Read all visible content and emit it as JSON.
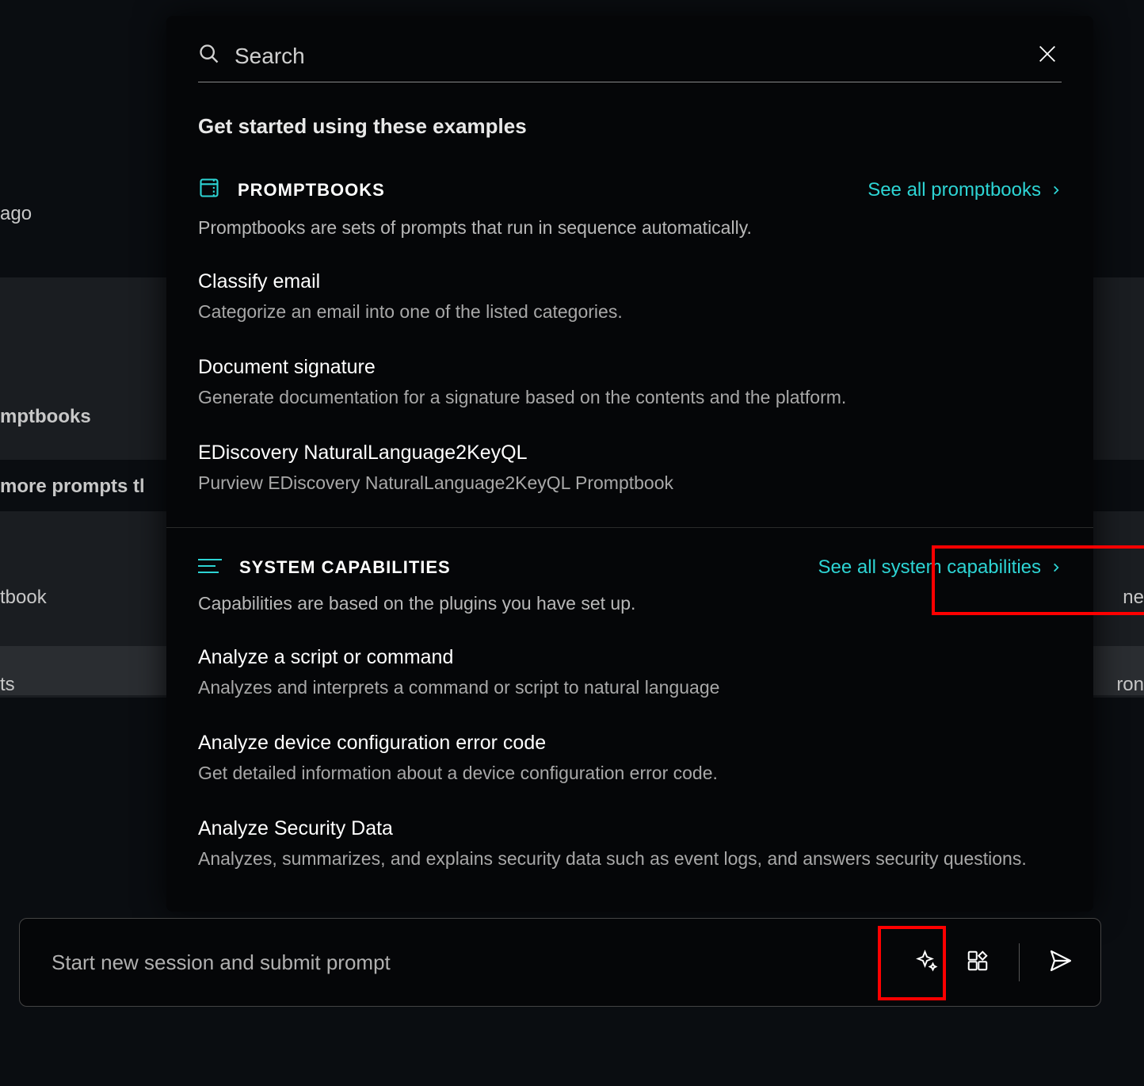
{
  "background": {
    "ago": "ago",
    "mptbooks": "mptbooks",
    "more_prompts": "more prompts tl",
    "tbook": "tbook",
    "ts": "ts",
    "ne": "ne",
    "ron": "ron"
  },
  "search": {
    "placeholder": "Search"
  },
  "intro_heading": "Get started using these examples",
  "promptbooks": {
    "title": "PROMPTBOOKS",
    "see_all": "See all promptbooks",
    "description": "Promptbooks are sets of prompts that run in sequence automatically.",
    "items": [
      {
        "title": "Classify email",
        "desc": "Categorize an email into one of the listed categories."
      },
      {
        "title": "Document signature",
        "desc": "Generate documentation for a signature based on the contents and the platform."
      },
      {
        "title": "EDiscovery NaturalLanguage2KeyQL",
        "desc": "Purview EDiscovery NaturalLanguage2KeyQL Promptbook"
      }
    ]
  },
  "capabilities": {
    "title": "SYSTEM CAPABILITIES",
    "see_all": "See all system capabilities",
    "description": "Capabilities are based on the plugins you have set up.",
    "items": [
      {
        "title": "Analyze a script or command",
        "desc": "Analyzes and interprets a command or script to natural language"
      },
      {
        "title": "Analyze device configuration error code",
        "desc": "Get detailed information about a device configuration error code."
      },
      {
        "title": "Analyze Security Data",
        "desc": "Analyzes, summarizes, and explains security data such as event logs, and answers security questions."
      }
    ]
  },
  "prompt_bar": {
    "placeholder": "Start new session and submit prompt"
  }
}
